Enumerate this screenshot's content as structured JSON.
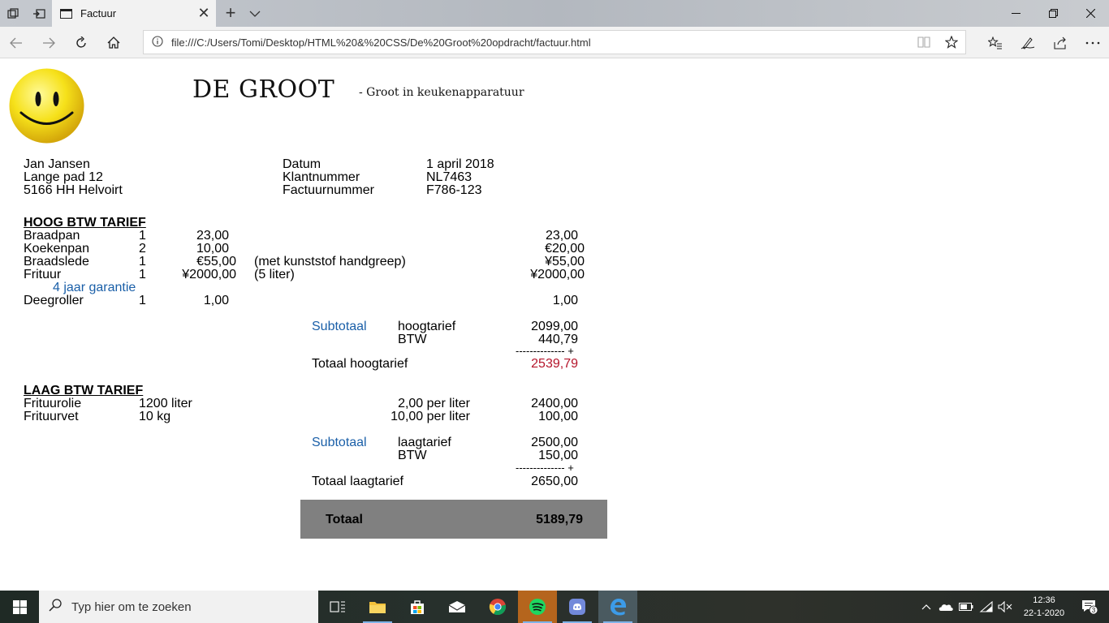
{
  "browser": {
    "tab_title": "Factuur",
    "tab_close": "✕",
    "new_tab": "+",
    "url": "file:///C:/Users/Tomi/Desktop/HTML%20&%20CSS/De%20Groot%20opdracht/factuur.html"
  },
  "header": {
    "brand": "DE GROOT",
    "slogan": "- Groot in keukenapparatuur"
  },
  "customer": {
    "name": "Jan Jansen",
    "street": "Lange pad 12",
    "city": "5166 HH Helvoirt"
  },
  "invoice_meta": {
    "date_label": "Datum",
    "date_value": "1 april 2018",
    "customer_no_label": "Klantnummer",
    "customer_no_value": "NL7463",
    "invoice_no_label": "Factuurnummer",
    "invoice_no_value": "F786-123"
  },
  "high_tariff": {
    "heading": "HOOG BTW TARIEF",
    "items": [
      {
        "name": "Braadpan",
        "qty": "1",
        "price": "23,00",
        "note": "",
        "total": "23,00"
      },
      {
        "name": "Koekenpan",
        "qty": "2",
        "price": "10,00",
        "note": "",
        "total": "€20,00"
      },
      {
        "name": "Braadslede",
        "qty": "1",
        "price": "€55,00",
        "note": "(met kunststof handgreep)",
        "total": "¥55,00"
      },
      {
        "name": "Frituur",
        "qty": "1",
        "price": "¥2000,00",
        "note": "(5 liter)",
        "total": "¥2000,00"
      },
      {
        "name": "Deegroller",
        "qty": "1",
        "price": "1,00",
        "note": "",
        "total": "1,00"
      }
    ],
    "warranty": "4 jaar garantie",
    "subtotal_label": "Subtotaal",
    "subtotal_desc": "hoogtarief",
    "subtotal_value": "2099,00",
    "vat_label": "BTW",
    "vat_value": "440,79",
    "separator": "-------------- +",
    "total_label": "Totaal hoogtarief",
    "total_value": "2539,79"
  },
  "low_tariff": {
    "heading": "LAAG BTW TARIEF",
    "items": [
      {
        "name": "Frituurolie",
        "qty": "1200 liter",
        "unit_price": "2,00 per liter",
        "total": "2400,00"
      },
      {
        "name": "Frituurvet",
        "qty": "10 kg",
        "unit_price": "10,00 per liter",
        "total": "100,00"
      }
    ],
    "subtotal_label": "Subtotaal",
    "subtotal_desc": "laagtarief",
    "subtotal_value": "2500,00",
    "vat_label": "BTW",
    "vat_value": "150,00",
    "separator": "-------------- +",
    "total_label": "Totaal laagtarief",
    "total_value": "2650,00"
  },
  "grand_total": {
    "label": "Totaal",
    "value": "5189,79"
  },
  "taskbar": {
    "search_placeholder": "Typ hier om te zoeken",
    "time": "12:36",
    "date": "22-1-2020",
    "notification_count": "3"
  },
  "colors": {
    "accent_blue": "#1a5fa8",
    "total_red": "#b5152b",
    "total_box": "#808080"
  }
}
